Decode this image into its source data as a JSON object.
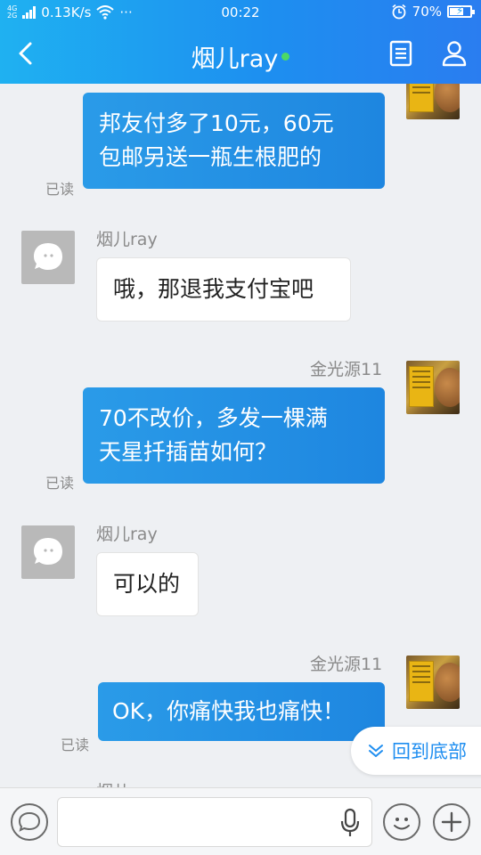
{
  "status_bar": {
    "network_top": "4G",
    "network_bottom": "2G",
    "speed": "0.13K/s",
    "more": "···",
    "time": "00:22",
    "battery": "70%",
    "battery_level": 0.7
  },
  "header": {
    "title": "烟儿ray",
    "online": true
  },
  "messages": [
    {
      "sender": "self",
      "text_lines": [
        "邦友付多了10元，60元",
        "包邮另送一瓶生根肥的"
      ],
      "read": "已读"
    },
    {
      "sender": "other",
      "name": "烟儿ray",
      "text_lines": [
        "哦，那退我支付宝吧"
      ]
    },
    {
      "sender": "self",
      "name": "金光源11",
      "text_lines": [
        "70不改价，多发一棵满",
        "天星扦插苗如何？"
      ],
      "read": "已读"
    },
    {
      "sender": "other",
      "name": "烟儿ray",
      "text_lines": [
        "可以的"
      ]
    },
    {
      "sender": "self",
      "name": "金光源11",
      "text_lines": [
        "OK，你痛快我也痛快！"
      ],
      "read": "已读"
    },
    {
      "sender": "other",
      "name": "烟儿"
    }
  ],
  "back_to_bottom": {
    "label": "回到底部"
  },
  "input_bar": {
    "placeholder": ""
  },
  "colors": {
    "header_start": "#1fb1f1",
    "header_end": "#2a7df0",
    "self_bubble": "#1e86e0",
    "online_dot": "#4cd964",
    "link": "#1f8ef0"
  },
  "icons": {
    "back": "chevron-left-icon",
    "profile_card": "document-icon",
    "person": "person-icon",
    "voice": "microphone-icon",
    "emoji": "smiley-icon",
    "add": "plus-icon",
    "chevron_down": "double-chevron-down-icon"
  }
}
